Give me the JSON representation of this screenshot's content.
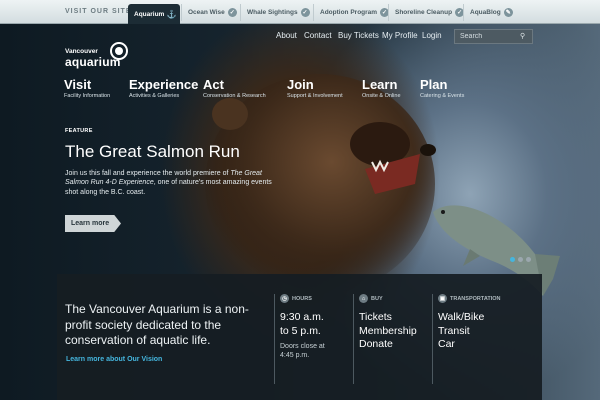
{
  "topbar": {
    "visit_label": "VISIT OUR SITES:",
    "sites": [
      {
        "label": "Aquarium",
        "icon": "whale-tail-icon",
        "active": true
      },
      {
        "label": "Ocean Wise",
        "icon": "check-icon"
      },
      {
        "label": "Whale Sightings",
        "icon": "check-icon"
      },
      {
        "label": "Adoption Program",
        "icon": "check-icon"
      },
      {
        "label": "Shoreline Cleanup",
        "icon": "check-icon"
      },
      {
        "label": "AquaBlog",
        "icon": "blog-icon"
      }
    ]
  },
  "logo": {
    "small": "Vancouver",
    "big": "aquarium",
    "mark": "TM"
  },
  "util_nav": {
    "about": "About",
    "contact": "Contact",
    "buy": "Buy Tickets",
    "profile": "My Profile",
    "login": "Login"
  },
  "search": {
    "placeholder": "Search"
  },
  "main_nav": [
    {
      "label": "Visit",
      "sub": "Facility Information"
    },
    {
      "label": "Experience",
      "sub": "Activities & Galleries"
    },
    {
      "label": "Act",
      "sub": "Conservation & Research"
    },
    {
      "label": "Join",
      "sub": "Support & Involvement"
    },
    {
      "label": "Learn",
      "sub": "Onsite & Online"
    },
    {
      "label": "Plan",
      "sub": "Catering & Events"
    }
  ],
  "feature": {
    "tag": "FEATURE",
    "title": "The Great Salmon Run",
    "text_a": "Join us this fall and experience the world premiere of ",
    "text_em": "The Great Salmon Run 4-D Experience",
    "text_b": ", one of nature's most amazing events shot along the B.C. coast.",
    "button": "Learn more"
  },
  "panel": {
    "mission": "The Vancouver Aquarium is a non-profit society dedicated to the conservation of aquatic life.",
    "vision_link": "Learn more about Our Vision",
    "hours": {
      "head": "HOURS",
      "line1": "9:30 a.m.",
      "line2": "to 5 p.m.",
      "note": "Doors close at 4:45 p.m."
    },
    "buy": {
      "head": "BUY",
      "line1": "Tickets",
      "line2": "Membership",
      "line3": "Donate"
    },
    "transport": {
      "head": "TRANSPORTATION",
      "line1": "Walk/Bike",
      "line2": "Transit",
      "line3": "Car"
    }
  },
  "colors": {
    "accent": "#45b6de",
    "topbar_active": "#1c2c35"
  }
}
